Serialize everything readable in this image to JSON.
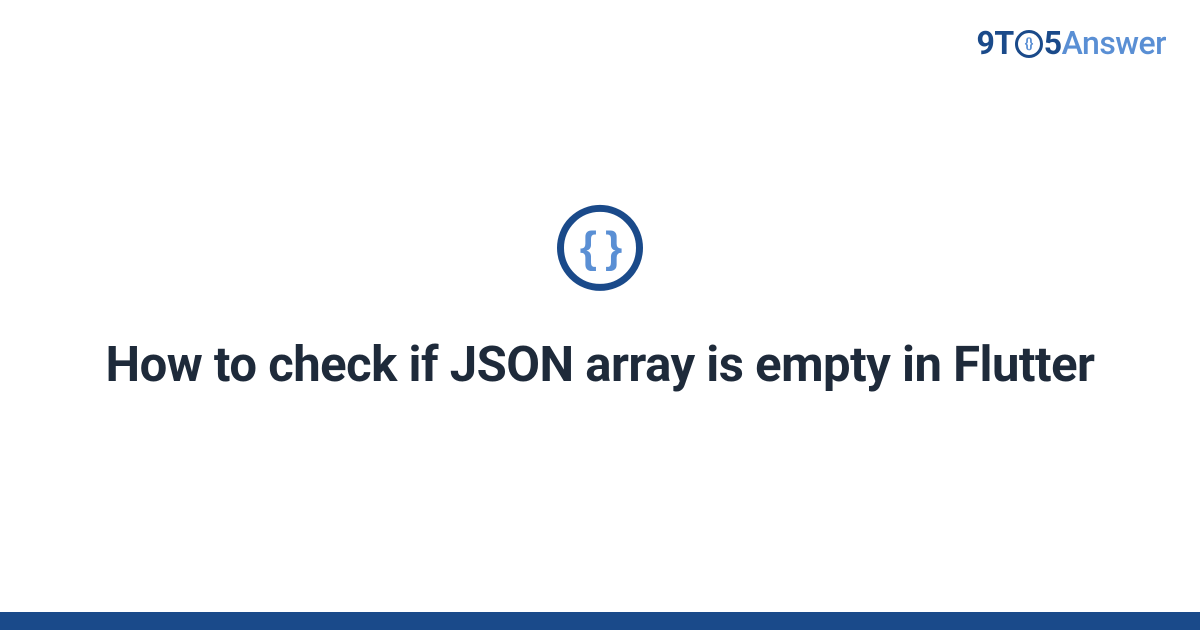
{
  "logo": {
    "prefix": "9T",
    "circle_inner": "{}",
    "mid": "5",
    "suffix": "Answer"
  },
  "icon": {
    "name": "json-braces-icon",
    "glyph": "{ }"
  },
  "title": "How to check if JSON array is empty in Flutter",
  "colors": {
    "primary_dark": "#1a4a8a",
    "primary_light": "#5a8fd4",
    "text": "#1e2a3a"
  }
}
